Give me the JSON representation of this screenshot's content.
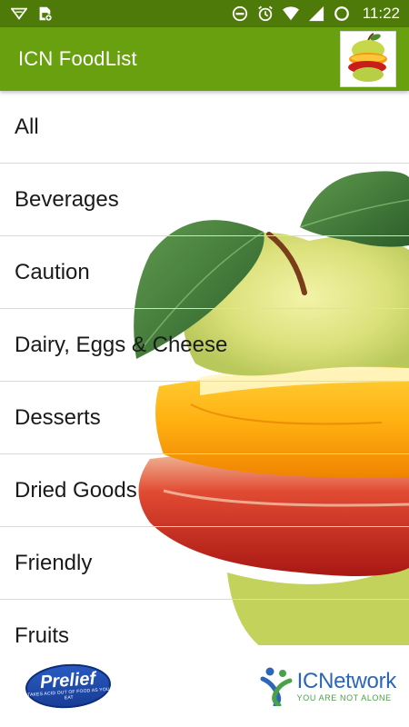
{
  "status_bar": {
    "time": "11:22",
    "left_icons": [
      "notification-icon",
      "sim-card-icon"
    ],
    "right_icons": [
      "do-not-disturb-icon",
      "alarm-icon",
      "wifi-icon",
      "signal-icon",
      "battery-icon"
    ]
  },
  "app_bar": {
    "title": "ICN FoodList",
    "logo": "fruit-stack-logo"
  },
  "categories": [
    "All",
    "Beverages",
    "Caution",
    "Dairy, Eggs & Cheese",
    "Desserts",
    "Dried Goods",
    "Friendly",
    "Fruits"
  ],
  "footer": {
    "left_logo": {
      "name": "Prelief",
      "tagline": "TAKES ACID OUT OF FOOD AS YOU EAT"
    },
    "right_logo": {
      "name": "ICNetwork",
      "tagline": "YOU ARE NOT ALONE"
    }
  },
  "colors": {
    "status_bar": "#4e7a0a",
    "app_bar": "#69a00f",
    "divider": "#dadada",
    "icn_blue": "#2b66b8",
    "icn_green": "#4aa14a"
  }
}
